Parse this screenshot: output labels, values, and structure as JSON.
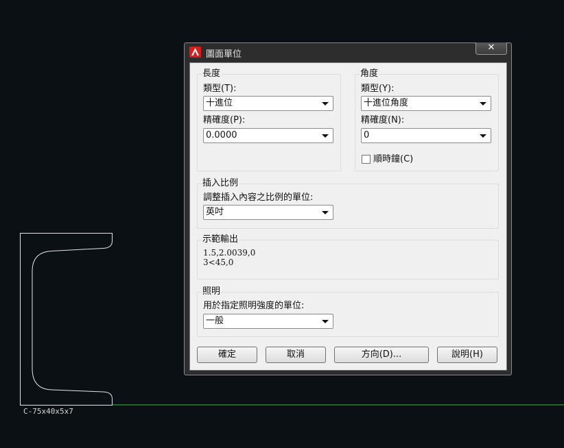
{
  "drawing": {
    "profile_label": "C-75x40x5x7",
    "profile_color": "#e6e6e6",
    "axis_color": "#2ec22e"
  },
  "dialog": {
    "title": "圖面單位",
    "close_glyph": "✕",
    "length": {
      "group_title": "長度",
      "type_label": "類型(T):",
      "type_value": "十進位",
      "precision_label": "精確度(P):",
      "precision_value": "0.0000"
    },
    "angle": {
      "group_title": "角度",
      "type_label": "類型(Y):",
      "type_value": "十進位角度",
      "precision_label": "精確度(N):",
      "precision_value": "0",
      "clockwise_label": "順時鐘(C)",
      "clockwise_checked": false
    },
    "insertion": {
      "group_title": "插入比例",
      "units_label": "調整插入內容之比例的單位:",
      "units_value": "英吋"
    },
    "sample": {
      "group_title": "示範輸出",
      "line1": "1.5,2.0039,0",
      "line2": "3<45,0"
    },
    "lighting": {
      "group_title": "照明",
      "units_label": "用於指定照明強度的單位:",
      "units_value": "一般"
    },
    "buttons": {
      "ok": "確定",
      "cancel": "取消",
      "direction": "方向(D)...",
      "help": "說明(H)"
    }
  }
}
